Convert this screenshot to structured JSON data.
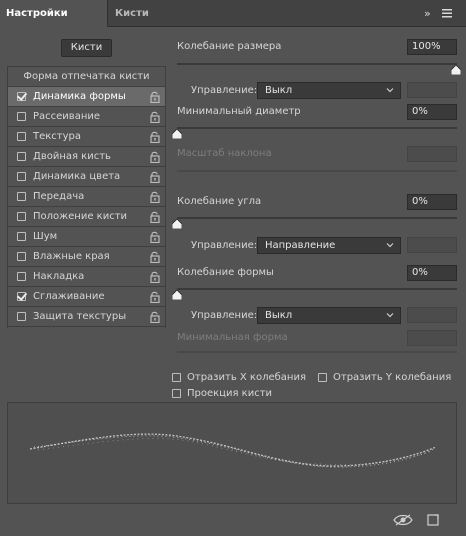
{
  "tabs": {
    "active": "Настройки кисти",
    "inactive": "Кисти"
  },
  "toolbar": {
    "expand_glyph": "»",
    "menu_icon": "hamburger-menu-icon"
  },
  "brushes_button": "Кисти",
  "list": {
    "header": "Форма отпечатка кисти",
    "items": [
      {
        "label": "Динамика формы",
        "checked": true,
        "selected": true
      },
      {
        "label": "Рассеивание",
        "checked": false,
        "selected": false
      },
      {
        "label": "Текстура",
        "checked": false,
        "selected": false
      },
      {
        "label": "Двойная кисть",
        "checked": false,
        "selected": false
      },
      {
        "label": "Динамика цвета",
        "checked": false,
        "selected": false
      },
      {
        "label": "Передача",
        "checked": false,
        "selected": false
      },
      {
        "label": "Положение кисти",
        "checked": false,
        "selected": false
      },
      {
        "label": "Шум",
        "checked": false,
        "selected": false
      },
      {
        "label": "Влажные края",
        "checked": false,
        "selected": false
      },
      {
        "label": "Накладка",
        "checked": false,
        "selected": false
      },
      {
        "label": "Сглаживание",
        "checked": true,
        "selected": false
      },
      {
        "label": "Защита текстуры",
        "checked": false,
        "selected": false
      }
    ]
  },
  "settings": {
    "size_jitter": {
      "label": "Колебание размера",
      "value": "100%",
      "level": 1.0
    },
    "size_control": {
      "label": "Управление:",
      "value": "Выкл"
    },
    "min_diameter": {
      "label": "Минимальный диаметр",
      "value": "0%",
      "level": 0.0
    },
    "tilt_scale": {
      "label": "Масштаб наклона"
    },
    "angle_jitter": {
      "label": "Колебание угла",
      "value": "0%",
      "level": 0.0
    },
    "angle_control": {
      "label": "Управление:",
      "value": "Направление"
    },
    "roundness_jitter": {
      "label": "Колебание формы",
      "value": "0%",
      "level": 0.0
    },
    "roundness_control": {
      "label": "Управление:",
      "value": "Выкл"
    },
    "min_roundness": {
      "label": "Минимальная форма"
    }
  },
  "flip_x": {
    "label": "Отразить X колебания",
    "checked": false
  },
  "flip_y": {
    "label": "Отразить Y колебания",
    "checked": false
  },
  "brush_projection": {
    "label": "Проекция кисти",
    "checked": false
  },
  "footer": {
    "left_icon": "eye-toggle-icon",
    "right_icon": "new-preset-icon"
  },
  "colors": {
    "panel_bg": "#535353",
    "tab_bar": "#424242",
    "field_bg": "#3a3a3a",
    "selected_row": "#6a6a6a"
  }
}
